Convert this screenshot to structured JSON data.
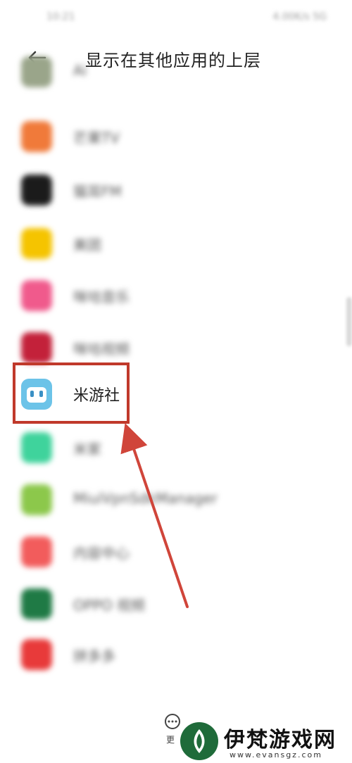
{
  "status_bar": {
    "left_text": "10:21",
    "right_text": "4.00K/s 5G"
  },
  "header": {
    "title": "显示在其他应用的上层"
  },
  "app_list": [
    {
      "name": "Ai",
      "icon_color": "#9aa58a",
      "partial": true
    },
    {
      "name": "芒果TV",
      "icon_color": "#f07a3a"
    },
    {
      "name": "猫耳FM",
      "icon_color": "#1b1b1b"
    },
    {
      "name": "美团",
      "icon_color": "#f5c400"
    },
    {
      "name": "咪咕音乐",
      "icon_color": "#f05a8c"
    },
    {
      "name": "咪咕视频",
      "icon_color": "#c3213a"
    },
    {
      "name": "米游社",
      "icon_color": "#6cc3e8",
      "focus": true
    },
    {
      "name": "米家",
      "icon_color": "#3fd39c"
    },
    {
      "name": "MiuiVpnSdkManager",
      "icon_color": "#8cc84b"
    },
    {
      "name": "内容中心",
      "icon_color": "#f25c5c"
    },
    {
      "name": "OPPO 视频",
      "icon_color": "#1f7a45"
    },
    {
      "name": "拼多多",
      "icon_color": "#e83a3a"
    }
  ],
  "footer": {
    "more_label": "更"
  },
  "watermark": {
    "brand": "伊梵游戏网",
    "url": "www.evansgz.com"
  },
  "colors": {
    "highlight": "#c0392b",
    "accent": "#222222"
  }
}
